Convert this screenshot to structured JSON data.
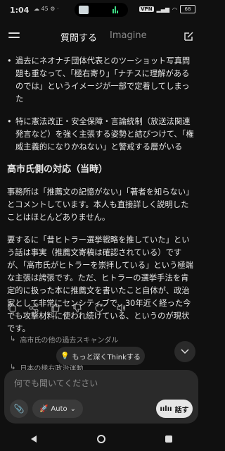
{
  "status": {
    "time": "1:04",
    "left_icons": "☁ 45 ⚙ ·",
    "vpn": "VPN",
    "battery": "68"
  },
  "header": {
    "tab_active": "質問する",
    "tab_inactive": "Imagine"
  },
  "content": {
    "bullet1": "過去にネオナチ団体代表とのツーショット写真問題も重なって、「極右寄り」「ナチスに理解があるのでは」というイメージが一部で定着してしまった",
    "bullet2": "特に憲法改正・安全保障・言論統制（放送法関連発言など）を強く主張する姿勢と結びつけて、「権威主義的になりかねない」と警戒する層がいる",
    "heading": "高市氏側の対応（当時）",
    "para1": "事務所は「推薦文の記憶がない」「著者を知らない」とコメントしています。本人も直接詳しく説明したことはほとんどありません。",
    "para2": "要するに「昔ヒトラー選挙戦略を推していた」という話は事実（推薦文寄稿は確認されている）ですが、「高市氏がヒトラーを崇拝している」という極端な主張は誇張です。ただ、ヒトラーの選挙手法を肯定的に扱った本に推薦文を書いたこと自体が、政治家として非常にセンシティブで、30年近く経った今でも攻撃材料に使われ続けている、というのが現状です。"
  },
  "related": [
    "高市氏の他の過去スキャンダル",
    "日本の極右政治運動"
  ],
  "think_button": "もっと深くThinkする",
  "input": {
    "placeholder": "何でも聞いてください",
    "mode": "Auto",
    "speak": "話す"
  }
}
